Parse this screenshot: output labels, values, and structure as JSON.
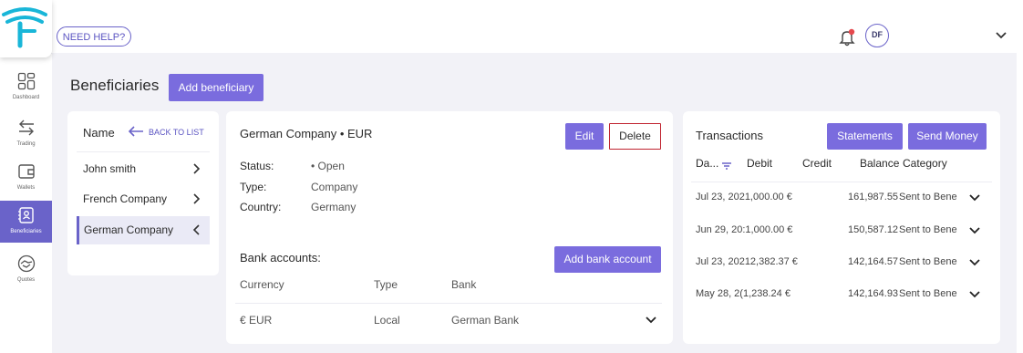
{
  "header": {
    "help_label": "NEED HELP?",
    "avatar_initials": "DF"
  },
  "sidebar": {
    "items": [
      {
        "label": "Dashboard",
        "icon": "dashboard-icon"
      },
      {
        "label": "Trading",
        "icon": "trading-arrows-icon"
      },
      {
        "label": "Wallets",
        "icon": "wallet-icon"
      },
      {
        "label": "Beneficiaries",
        "icon": "beneficiaries-icon",
        "active": true
      },
      {
        "label": "Quotes",
        "icon": "handshake-icon"
      }
    ]
  },
  "page": {
    "title": "Beneficiaries",
    "add_beneficiary_label": "Add beneficiary"
  },
  "list": {
    "header_label": "Name",
    "back_label": "BACK TO LIST",
    "items": [
      {
        "name": "John smith"
      },
      {
        "name": "French Company"
      },
      {
        "name": "German Company",
        "selected": true
      }
    ]
  },
  "detail": {
    "title": "German Company • EUR",
    "edit_label": "Edit",
    "delete_label": "Delete",
    "fields": [
      {
        "label": "Status:",
        "value": "• Open"
      },
      {
        "label": "Type:",
        "value": "Company"
      },
      {
        "label": "Country:",
        "value": "Germany"
      }
    ],
    "bank_accounts_title": "Bank accounts:",
    "add_bank_label": "Add bank account",
    "bank_columns": [
      "Currency",
      "Type",
      "Bank"
    ],
    "bank_rows": [
      {
        "currency": "€ EUR",
        "type": "Local",
        "bank": "German Bank"
      }
    ]
  },
  "transactions": {
    "title": "Transactions",
    "statements_label": "Statements",
    "send_money_label": "Send Money",
    "columns": [
      "Da...",
      "Debit",
      "Credit",
      "Balance",
      "Category"
    ],
    "rows": [
      {
        "date_debit": "Jul 23, 2021,000.00 €",
        "balance": "161,987.55",
        "category": "Sent to Bene"
      },
      {
        "date_debit": "Jun 29, 20:1,000.00 €",
        "balance": "150,587.12",
        "category": "Sent to Bene"
      },
      {
        "date_debit": "Jul 23, 20212,382.37 €",
        "balance": "142,164.57",
        "category": "Sent to Bene"
      },
      {
        "date_debit": "May 28, 2(1,238.24 €",
        "balance": "142,164.93",
        "category": "Sent to Bene"
      }
    ]
  },
  "colors": {
    "accent": "#7a6cde",
    "danger": "#c0232f",
    "notification": "#e5484d"
  }
}
